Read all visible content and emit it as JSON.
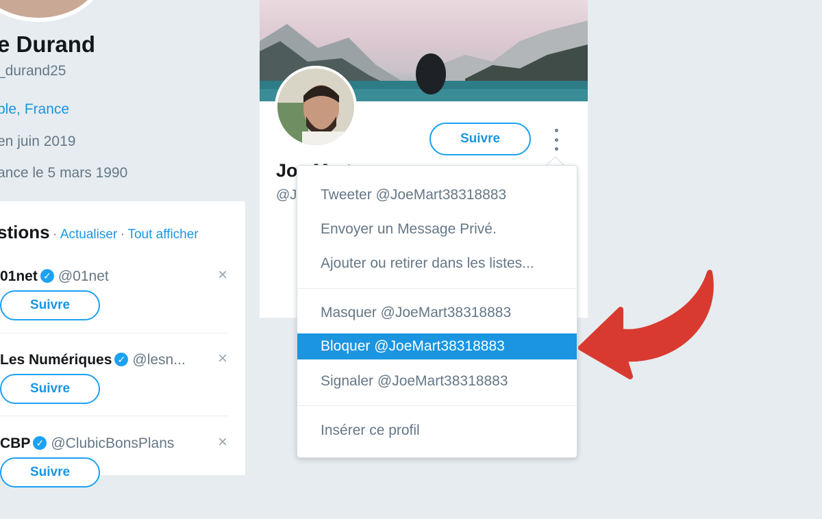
{
  "profile": {
    "name": "e Durand",
    "handle": "_durand25",
    "location": "ble, France",
    "joined": "en juin 2019",
    "birth": "ance le 5 mars 1990"
  },
  "suggestions": {
    "title": "stions",
    "separator": "·",
    "refresh": "Actualiser",
    "show_all": "Tout afficher",
    "close_glyph": "×",
    "verified_glyph": "✓",
    "items": [
      {
        "name": "01net",
        "handle": "@01net",
        "follow": "Suivre"
      },
      {
        "name": "Les Numériques",
        "handle": "@lesn...",
        "follow": "Suivre"
      },
      {
        "name": "CBP",
        "handle": "@ClubicBonsPlans",
        "follow": "Suivre"
      }
    ]
  },
  "card": {
    "follow_label": "Suivre",
    "name": "Joe Mart",
    "handle": "@J"
  },
  "menu": {
    "items": [
      "Tweeter @JoeMart38318883",
      "Envoyer un Message Privé.",
      "Ajouter ou retirer dans les listes...",
      "Masquer @JoeMart38318883",
      "Bloquer @JoeMart38318883",
      "Signaler @JoeMart38318883",
      "Insérer ce profil"
    ],
    "highlighted_index": 4
  },
  "colors": {
    "accent": "#1da1f2",
    "highlight": "#1b95e0",
    "arrow": "#d93a30"
  },
  "icons": [
    "more-options-icon",
    "verified-icon",
    "close-icon",
    "red-arrow-icon"
  ]
}
